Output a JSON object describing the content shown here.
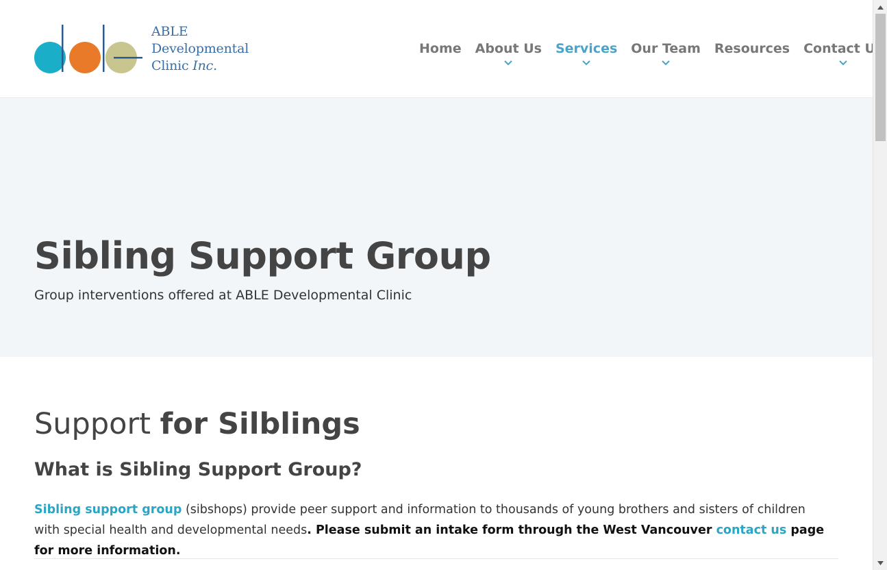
{
  "logo": {
    "line1": "ABLE",
    "line2": "Developmental",
    "line3_plain": "Clinic ",
    "line3_italic": "Inc.",
    "colors": {
      "teal": "#1aaec9",
      "orange": "#e87a2a",
      "olive": "#c9c58f",
      "navy": "#2b5a8e"
    }
  },
  "nav": {
    "items": [
      {
        "label": "Home",
        "dropdown": false,
        "active": false
      },
      {
        "label": "About Us",
        "dropdown": true,
        "active": false
      },
      {
        "label": "Services",
        "dropdown": true,
        "active": true
      },
      {
        "label": "Our Team",
        "dropdown": true,
        "active": false
      },
      {
        "label": "Resources",
        "dropdown": false,
        "active": false
      },
      {
        "label": "Contact Us",
        "dropdown": true,
        "active": false
      }
    ],
    "chevron_icon": "chevron-down-icon",
    "accent": "#4aa3c9"
  },
  "hero": {
    "title": "Sibling Support Group",
    "subtitle": "Group interventions offered at ABLE Developmental Clinic"
  },
  "content": {
    "section_title_light": "Support ",
    "section_title_bold": "for Silblings",
    "subhead": "What is Sibling Support Group?",
    "para": {
      "link1": "Sibling support group",
      "text1": " (sibshops) provide peer support and information to thousands of young brothers and sisters of children with special health and developmental needs",
      "strong1": ". Please submit an intake form through the West Vancouver ",
      "link2": "contact us",
      "strong2": " page for more information."
    }
  },
  "scrollbar": {
    "up_icon": "scroll-up-arrow-icon",
    "down_icon": "scroll-down-arrow-icon"
  }
}
